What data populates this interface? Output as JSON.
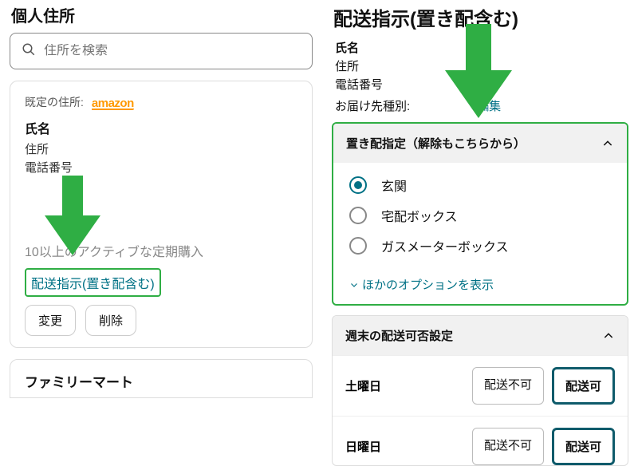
{
  "left": {
    "heading": "個人住所",
    "search_placeholder": "住所を検索",
    "default_label": "既定の住所:",
    "brand": "amazon",
    "name_label": "氏名",
    "address_label": "住所",
    "phone_label": "電話番号",
    "subscriptions": "10以上のアクティブな定期購入",
    "delivery_link": "配送指示(置き配含む)",
    "change_btn": "変更",
    "delete_btn": "削除",
    "second_card_title": "ファミリーマート"
  },
  "right": {
    "heading": "配送指示(置き配含む)",
    "name_label": "氏名",
    "address_label": "住所",
    "phone_label": "電話番号",
    "type_label": "お届け先種別:",
    "edit": "編集",
    "panel_title": "置き配指定（解除もこちらから）",
    "options": [
      {
        "label": "玄関",
        "selected": true
      },
      {
        "label": "宅配ボックス",
        "selected": false
      },
      {
        "label": "ガスメーターボックス",
        "selected": false
      }
    ],
    "more_options": "ほかのオプションを表示",
    "weekend_title": "週末の配送可否設定",
    "days": [
      {
        "day": "土曜日",
        "off_label": "配送不可",
        "on_label": "配送可"
      },
      {
        "day": "日曜日",
        "off_label": "配送不可",
        "on_label": "配送可"
      }
    ]
  }
}
